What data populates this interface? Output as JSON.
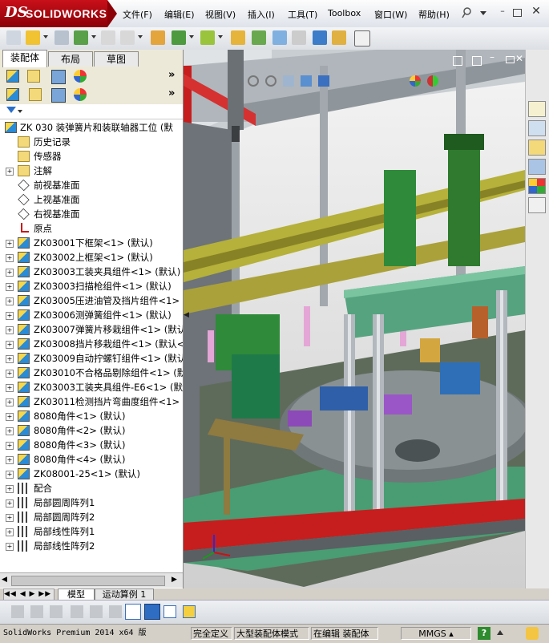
{
  "app": {
    "brand": "SOLIDWORKS",
    "brand_prefix": "DS",
    "accent": "#c8101a"
  },
  "menu": [
    "文件(F)",
    "编辑(E)",
    "视图(V)",
    "插入(I)",
    "工具(T)",
    "Toolbox",
    "窗口(W)",
    "帮助(H)"
  ],
  "panel_tabs": [
    "装配体",
    "布局",
    "草图"
  ],
  "tree": {
    "root": "ZK 030 装弹簧片和装联轴器工位 (默",
    "items": [
      {
        "label": "历史记录",
        "icon": "history-icon",
        "expand": false
      },
      {
        "label": "传感器",
        "icon": "sensor-icon",
        "expand": false
      },
      {
        "label": "注解",
        "icon": "annotation-icon",
        "expand": true
      },
      {
        "label": "前视基准面",
        "icon": "plane-icon",
        "expand": false
      },
      {
        "label": "上视基准面",
        "icon": "plane-icon",
        "expand": false
      },
      {
        "label": "右视基准面",
        "icon": "plane-icon",
        "expand": false
      },
      {
        "label": "原点",
        "icon": "origin-icon",
        "expand": false
      },
      {
        "label": "ZK03001下框架<1> (默认)",
        "icon": "assembly-icon",
        "expand": true
      },
      {
        "label": "ZK03002上框架<1> (默认)",
        "icon": "assembly-icon",
        "expand": true
      },
      {
        "label": "ZK03003工装夹具组件<1> (默认)",
        "icon": "assembly-icon",
        "expand": true
      },
      {
        "label": "ZK03003扫描枪组件<1> (默认)",
        "icon": "assembly-icon",
        "expand": true
      },
      {
        "label": "ZK03005压进油管及挡片组件<1> (",
        "icon": "assembly-icon",
        "expand": true
      },
      {
        "label": "ZK03006测弹簧组件<1> (默认)",
        "icon": "assembly-icon",
        "expand": true
      },
      {
        "label": "ZK03007弹簧片移栽组件<1> (默认",
        "icon": "assembly-icon",
        "expand": true
      },
      {
        "label": "ZK03008挡片移栽组件<1> (默认<显",
        "icon": "assembly-icon",
        "expand": true
      },
      {
        "label": "ZK03009自动拧螺钉组件<1> (默认",
        "icon": "assembly-icon",
        "expand": true
      },
      {
        "label": "ZK03010不合格品剔除组件<1> (默",
        "icon": "assembly-icon",
        "expand": true
      },
      {
        "label": "ZK03003工装夹具组件-E6<1> (默认",
        "icon": "assembly-icon",
        "expand": true
      },
      {
        "label": "ZK03011检测挡片弯曲度组件<1> (",
        "icon": "assembly-icon",
        "expand": true
      },
      {
        "label": "8080角件<1> (默认)",
        "icon": "assembly-icon",
        "expand": true
      },
      {
        "label": "8080角件<2> (默认)",
        "icon": "assembly-icon",
        "expand": true
      },
      {
        "label": "8080角件<3> (默认)",
        "icon": "assembly-icon",
        "expand": true
      },
      {
        "label": "8080角件<4> (默认)",
        "icon": "assembly-icon",
        "expand": true
      },
      {
        "label": "ZK08001-25<1> (默认)",
        "icon": "assembly-icon",
        "expand": true
      },
      {
        "label": "配合",
        "icon": "mates-icon",
        "expand": true
      },
      {
        "label": "局部圆周阵列1",
        "icon": "circular-pattern-icon",
        "expand": true
      },
      {
        "label": "局部圆周阵列2",
        "icon": "circular-pattern-icon",
        "expand": true
      },
      {
        "label": "局部线性阵列1",
        "icon": "linear-pattern-icon",
        "expand": true
      },
      {
        "label": "局部线性阵列2",
        "icon": "linear-pattern-icon",
        "expand": true
      }
    ]
  },
  "bottom_tabs": [
    "模型",
    "运动算例 1"
  ],
  "status": {
    "app_version": "SolidWorks Premium 2014 x64 版",
    "definition": "完全定义",
    "mode": "大型装配体模式",
    "editing": "在编辑 装配体",
    "units": "MMGS"
  },
  "toolbox_label": "Toolbox"
}
